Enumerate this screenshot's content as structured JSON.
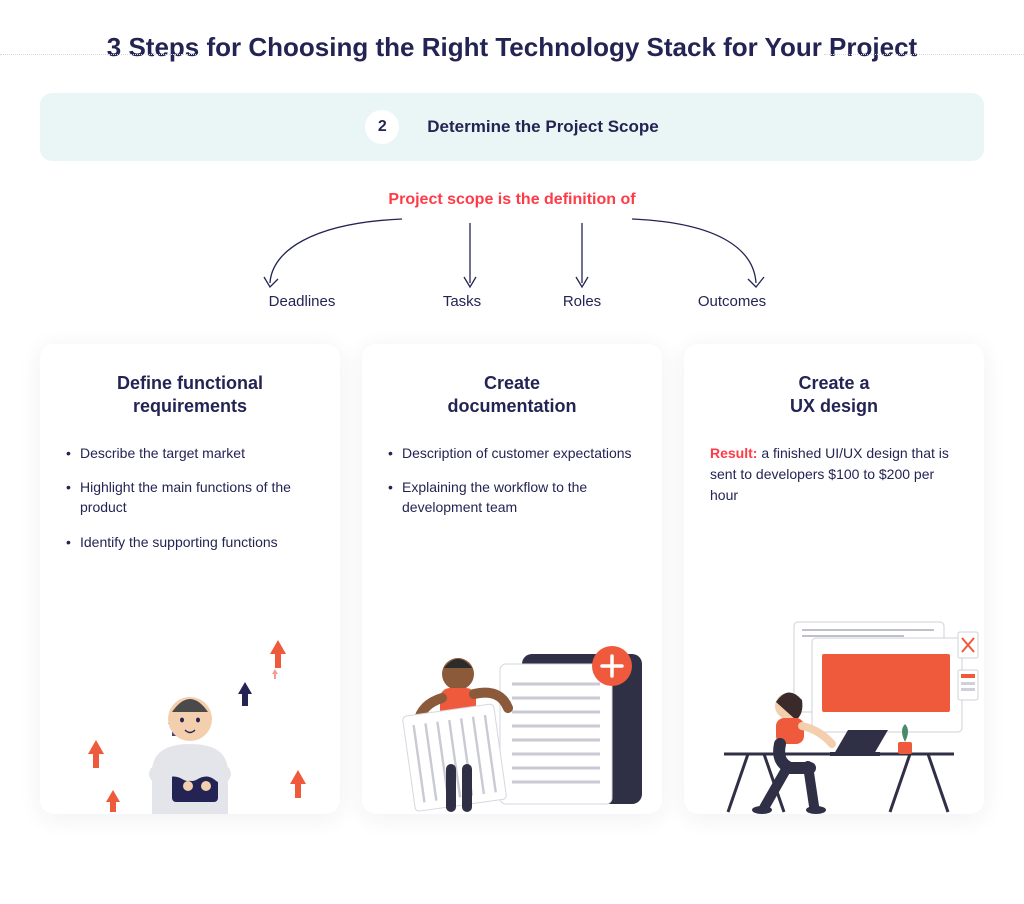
{
  "title": "3 Steps for Choosing the Right\nTechnology Stack for Your Project",
  "step": {
    "number": "2",
    "label": "Determine the Project Scope"
  },
  "scope": {
    "heading": "Project scope is the definition of",
    "items": [
      "Deadlines",
      "Tasks",
      "Roles",
      "Outcomes"
    ]
  },
  "cards": [
    {
      "title": "Define functional\nrequirements",
      "bullets": [
        "Describe the target market",
        "Highlight the main functions of the product",
        "Identify the supporting functions"
      ]
    },
    {
      "title": "Create\ndocumentation",
      "bullets": [
        "Description of customer expectations",
        "Explaining the workflow to the development team"
      ]
    },
    {
      "title": "Create a\nUX design",
      "result_label": "Result:",
      "result_text": " a finished UI/UX design that is sent to developers $100 to $200 per hour"
    }
  ],
  "colors": {
    "accent": "#ff3b47",
    "accent_orange": "#f05a3c",
    "ink": "#242454",
    "banner_bg": "#eaf6f5"
  }
}
